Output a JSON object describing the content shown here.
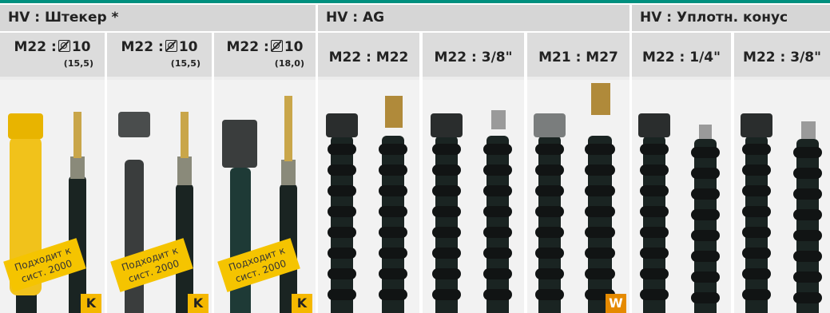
{
  "groups": [
    {
      "title": "HV : Штекер *"
    },
    {
      "title": "HV : AG"
    },
    {
      "title": "HV : Уплотн. конус"
    }
  ],
  "columns": [
    {
      "prefix": "M22 :",
      "value": "10",
      "sub": "(15,5)",
      "note": "Подходит к сист. 2000",
      "badge": "K"
    },
    {
      "prefix": "M22 :",
      "value": "10",
      "sub": "(15,5)",
      "note": "Подходит к сист. 2000",
      "badge": "K"
    },
    {
      "prefix": "M22 :",
      "value": "10",
      "sub": "(18,0)",
      "note": "Подходит к сист. 2000",
      "badge": "K"
    },
    {
      "label": "M22 : M22"
    },
    {
      "label": "M22 : 3/8\""
    },
    {
      "label": "M21 : M27",
      "badge": "W"
    },
    {
      "label": "M22 : 1/4\""
    },
    {
      "label": "M22 : 3/8\""
    }
  ],
  "colors": {
    "accent": "#00907f",
    "badge_k": "#f5b800",
    "badge_w": "#e58a00",
    "hose": "#1a2422"
  }
}
